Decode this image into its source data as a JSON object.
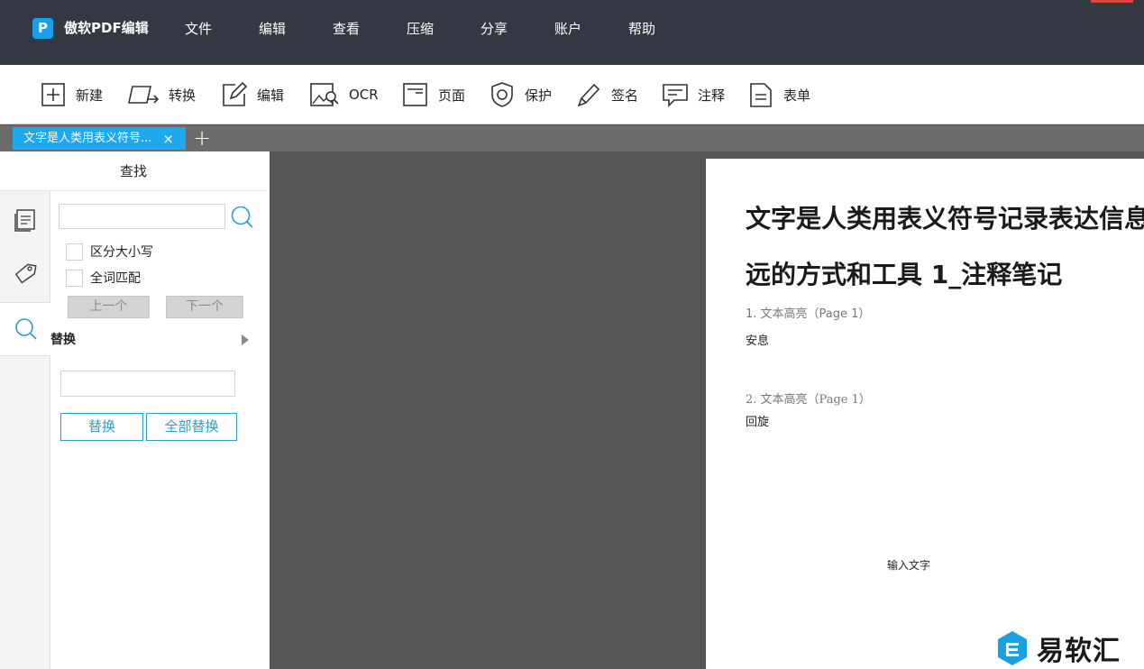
{
  "app": {
    "logo_letter": "P",
    "title": "傲软PDF编辑"
  },
  "menu": [
    {
      "label": "文件"
    },
    {
      "label": "编辑"
    },
    {
      "label": "查看"
    },
    {
      "label": "压缩"
    },
    {
      "label": "分享"
    },
    {
      "label": "账户"
    },
    {
      "label": "帮助"
    }
  ],
  "toolbar": {
    "new": "新建",
    "convert": "转换",
    "edit": "编辑",
    "ocr": "OCR",
    "page": "页面",
    "protect": "保护",
    "sign": "签名",
    "annotate": "注释",
    "form": "表单"
  },
  "tabs": {
    "active_label": "文字是人类用表义符号...",
    "close_glyph": "×",
    "add_glyph": "+"
  },
  "find_panel": {
    "title": "查找",
    "search_value": "",
    "case_sensitive_label": "区分大小写",
    "whole_word_label": "全词匹配",
    "prev_label": "上一个",
    "next_label": "下一个",
    "replace_section_label": "替换",
    "replace_value": "",
    "replace_label": "替换",
    "replace_all_label": "全部替换"
  },
  "document": {
    "title_line1": "文字是人类用表义符号记录表达信息以",
    "title_line2": "远的方式和工具 1_注释笔记",
    "notes": [
      {
        "head": "1. 文本高亮（Page 1）",
        "body": "安息"
      },
      {
        "head": "2. 文本高亮（Page 1）",
        "body": "回旋"
      }
    ],
    "input_text": "输入文字"
  },
  "watermark": {
    "text": "易软汇"
  },
  "colors": {
    "titlebar_bg": "#343842",
    "accent_blue": "#1ea8ef",
    "button_outline": "#2f9fc4",
    "viewer_bg": "#565656"
  }
}
